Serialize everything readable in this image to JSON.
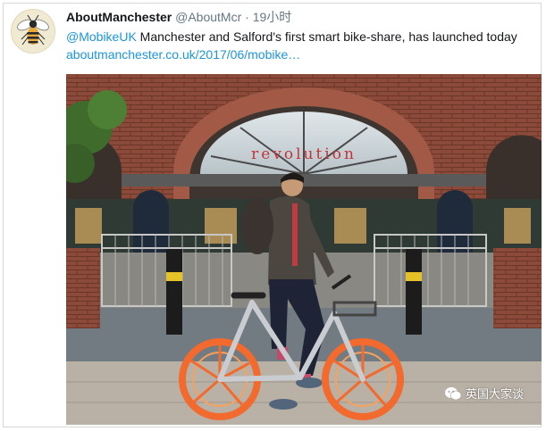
{
  "tweet": {
    "author_name": "AboutManchester",
    "author_handle": "@AboutMcr",
    "separator": "·",
    "timestamp": "19小时",
    "mention": "@MobikeUK",
    "text": " Manchester and Salford's first smart bike-share, has launched today ",
    "link_text": "aboutmanchester.co.uk/2017/06/mobike…"
  },
  "photo": {
    "sign_text": "revolution",
    "watermark": "英国大家谈"
  },
  "colors": {
    "link": "#1b95e0",
    "bike_frame": "#c9ccd1",
    "bike_wheel": "#f26a2e",
    "brick": "#8c4a3a"
  }
}
